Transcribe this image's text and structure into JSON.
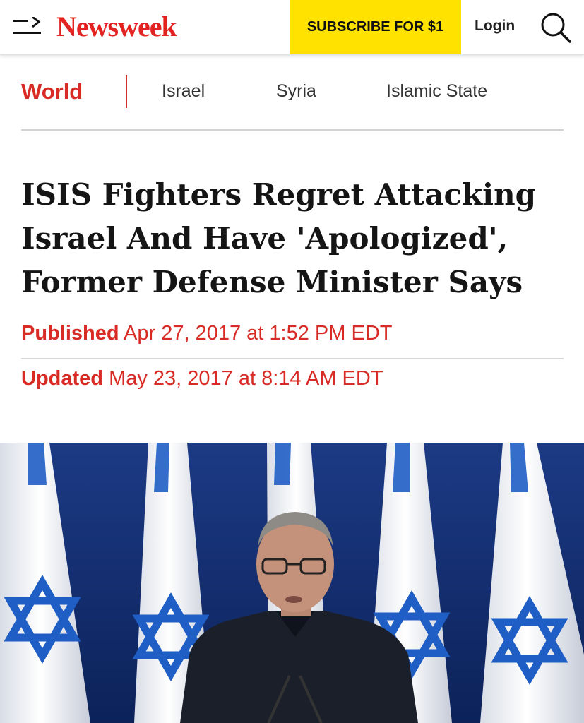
{
  "header": {
    "logo_text": "Newsweek",
    "subscribe_label": "SUBSCRIBE FOR $1",
    "login_label": "Login",
    "colors": {
      "brand_red": "#e32322",
      "subscribe_yellow": "#ffe200"
    }
  },
  "subnav": {
    "section": "World",
    "topics": [
      "Israel",
      "Syria",
      "Islamic State"
    ]
  },
  "article": {
    "headline": "ISIS Fighters Regret Attacking Israel And Have 'Apologized', Former Defense Minister Says",
    "published_label": "Published",
    "published_date": "Apr 27, 2017 at 1:52 PM EDT",
    "updated_label": "Updated",
    "updated_date": "May 23, 2017 at 8:14 AM EDT"
  },
  "icons": [
    "menu-icon",
    "search-icon"
  ]
}
